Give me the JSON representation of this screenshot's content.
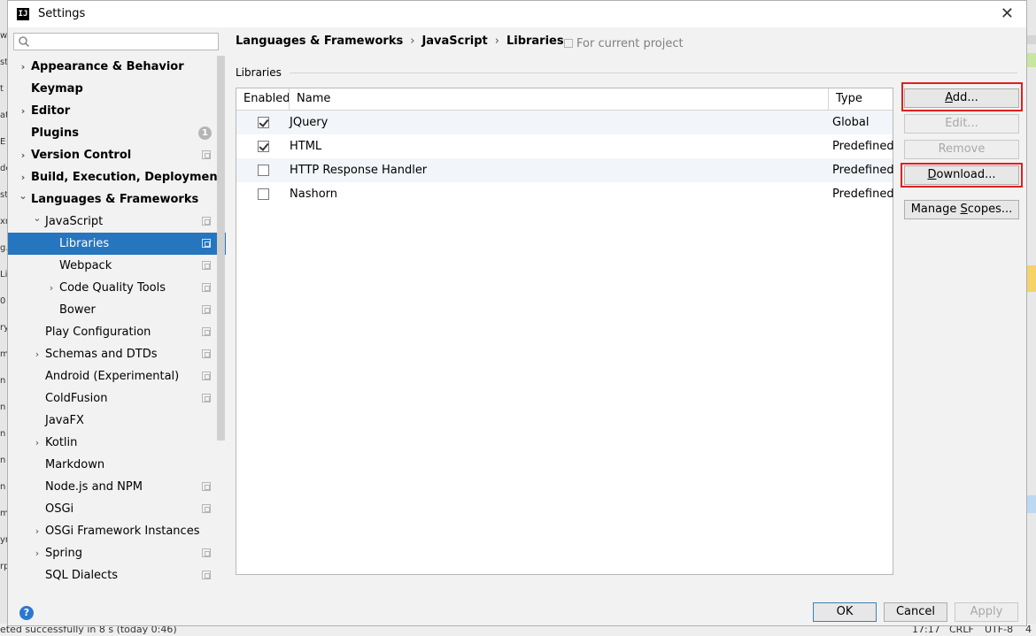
{
  "window": {
    "title": "Settings",
    "app_icon_text": "IJ"
  },
  "search": {
    "placeholder": ""
  },
  "tree": [
    {
      "label": "Appearance & Behavior",
      "bold": true,
      "chevron": "right",
      "project_icon": false
    },
    {
      "label": "Keymap",
      "bold": true,
      "chevron": "",
      "project_icon": false
    },
    {
      "label": "Editor",
      "bold": true,
      "chevron": "right",
      "project_icon": false
    },
    {
      "label": "Plugins",
      "bold": true,
      "chevron": "",
      "project_icon": false,
      "badge": "1"
    },
    {
      "label": "Version Control",
      "bold": true,
      "chevron": "right",
      "project_icon": true
    },
    {
      "label": "Build, Execution, Deployment",
      "bold": true,
      "chevron": "right",
      "project_icon": false
    },
    {
      "label": "Languages & Frameworks",
      "bold": true,
      "chevron": "down",
      "project_icon": false
    },
    {
      "label": "JavaScript",
      "bold": false,
      "chevron": "down",
      "project_icon": true
    },
    {
      "label": "Libraries",
      "bold": false,
      "chevron": "",
      "project_icon": true,
      "selected": true
    },
    {
      "label": "Webpack",
      "bold": false,
      "chevron": "",
      "project_icon": true
    },
    {
      "label": "Code Quality Tools",
      "bold": false,
      "chevron": "right",
      "project_icon": true
    },
    {
      "label": "Bower",
      "bold": false,
      "chevron": "",
      "project_icon": true
    },
    {
      "label": "Play Configuration",
      "bold": false,
      "chevron": "",
      "project_icon": true
    },
    {
      "label": "Schemas and DTDs",
      "bold": false,
      "chevron": "right",
      "project_icon": true
    },
    {
      "label": "Android (Experimental)",
      "bold": false,
      "chevron": "",
      "project_icon": true
    },
    {
      "label": "ColdFusion",
      "bold": false,
      "chevron": "",
      "project_icon": true
    },
    {
      "label": "JavaFX",
      "bold": false,
      "chevron": "",
      "project_icon": false
    },
    {
      "label": "Kotlin",
      "bold": false,
      "chevron": "right",
      "project_icon": false
    },
    {
      "label": "Markdown",
      "bold": false,
      "chevron": "",
      "project_icon": false
    },
    {
      "label": "Node.js and NPM",
      "bold": false,
      "chevron": "",
      "project_icon": true
    },
    {
      "label": "OSGi",
      "bold": false,
      "chevron": "",
      "project_icon": true
    },
    {
      "label": "OSGi Framework Instances",
      "bold": false,
      "chevron": "right",
      "project_icon": false
    },
    {
      "label": "Spring",
      "bold": false,
      "chevron": "right",
      "project_icon": true
    },
    {
      "label": "SQL Dialects",
      "bold": false,
      "chevron": "",
      "project_icon": true
    }
  ],
  "breadcrumb": [
    "Languages & Frameworks",
    "JavaScript",
    "Libraries"
  ],
  "breadcrumb_separator": "›",
  "scope_note": "For current project",
  "section_label": "Libraries",
  "table": {
    "headers": {
      "enabled": "Enabled",
      "name": "Name",
      "type": "Type"
    },
    "rows": [
      {
        "enabled": true,
        "name": "JQuery",
        "type": "Global"
      },
      {
        "enabled": true,
        "name": "HTML",
        "type": "Predefined"
      },
      {
        "enabled": false,
        "name": "HTTP Response Handler",
        "type": "Predefined"
      },
      {
        "enabled": false,
        "name": "Nashorn",
        "type": "Predefined"
      }
    ]
  },
  "buttons": {
    "add": {
      "mnemonic": "A",
      "rest": "dd...",
      "enabled": true,
      "highlighted": true
    },
    "edit": {
      "label": "Edit...",
      "enabled": false
    },
    "remove": {
      "label": "Remove",
      "enabled": false
    },
    "download": {
      "mnemonic": "D",
      "rest": "ownload...",
      "enabled": true,
      "highlighted": true
    },
    "manage_scopes": {
      "pre": "Manage ",
      "mnemonic": "S",
      "rest": "copes...",
      "enabled": true
    }
  },
  "footer": {
    "help": "?",
    "ok": "OK",
    "cancel": "Cancel",
    "apply": "Apply"
  },
  "background": {
    "left_fragments": [
      "w",
      "st",
      "t",
      "at",
      "E",
      "de",
      "st",
      "xn",
      "g.",
      "Li",
      "0",
      "ry",
      "m",
      "n",
      "n",
      "n",
      "n",
      "n",
      "m",
      "yr",
      "rp"
    ],
    "status_left": "eted successfully in 8 s (today 0:46)",
    "status_right": [
      "17:17",
      "CRLF",
      "UTF-8",
      "4"
    ],
    "colors": {
      "highlight_frame": "#e02020",
      "selection": "#2675bf",
      "help": "#2b78d0"
    }
  }
}
